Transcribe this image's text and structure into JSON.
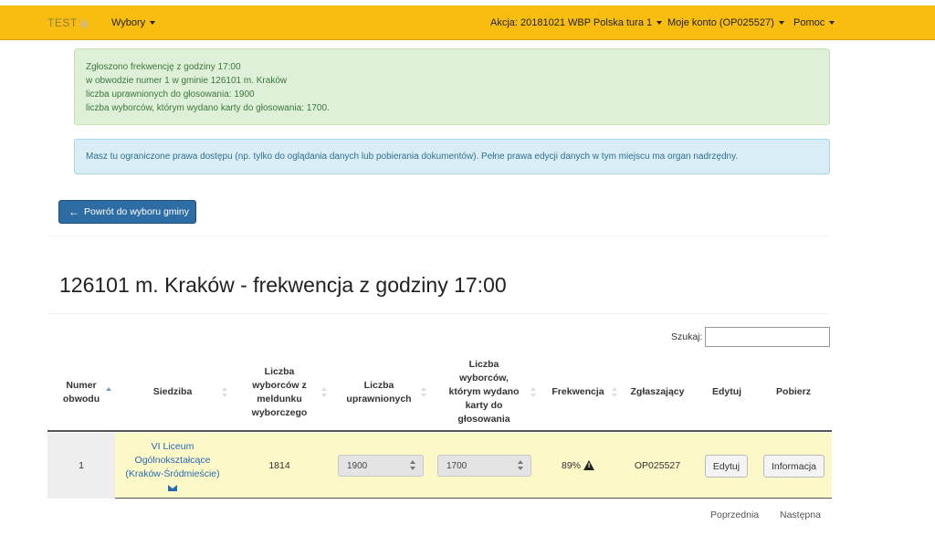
{
  "navbar": {
    "brand": "TEST",
    "menu_elections": "Wybory",
    "action": "Akcja: 20181021 WBP Polska tura 1",
    "account": "Moje konto (OP025527)",
    "help": "Pomoc"
  },
  "alerts": {
    "success_lines": [
      "Zgłoszono frekwencję z godziny 17:00",
      "w obwodzie numer 1 w gminie 126101 m. Kraków",
      "liczba uprawnionych do głosowania: 1900",
      "liczba wyborców, którym wydano karty do głosowania: 1700."
    ],
    "info": "Masz tu ograniczone prawa dostępu (np. tylko do oglądania danych lub pobierania dokumentów). Pełne prawa edycji danych w tym miejscu ma organ nadrzędny."
  },
  "back_button": "Powrót do wyboru gminy",
  "page_title": "126101 m. Kraków - frekwencja z godziny 17:00",
  "search": {
    "label": "Szukaj:",
    "value": ""
  },
  "table": {
    "headers": {
      "numer": [
        "Numer",
        "obwodu"
      ],
      "siedziba": "Siedziba",
      "meldunek": [
        "Liczba",
        "wyborców z",
        "meldunku",
        "wyborczego"
      ],
      "uprawnieni": [
        "Liczba",
        "uprawnionych"
      ],
      "karty": [
        "Liczba",
        "wyborców,",
        "którym wydano",
        "karty do",
        "głosowania"
      ],
      "frekwencja": "Frekwencja",
      "zglaszajacy": "Zgłaszający",
      "edytuj": "Edytuj",
      "pobierz": "Pobierz"
    },
    "rows": [
      {
        "numer": "1",
        "siedziba": [
          "VI Liceum",
          "Ogólnokształcące",
          "(Kraków-Śródmieście)"
        ],
        "meldunek": "1814",
        "uprawnieni": "1900",
        "karty": "1700",
        "frekwencja": "89%",
        "zglaszajacy": "OP025527",
        "edit_label": "Edytuj",
        "info_label": "Informacja"
      }
    ]
  },
  "pager": {
    "prev": "Poprzednia",
    "next": "Następna"
  },
  "colors": {
    "navbar": "#f9bd10",
    "success_bg": "#dff0d8",
    "info_bg": "#d9edf7",
    "primary": "#2e6da4",
    "row_highlight": "#fcf8c8"
  }
}
